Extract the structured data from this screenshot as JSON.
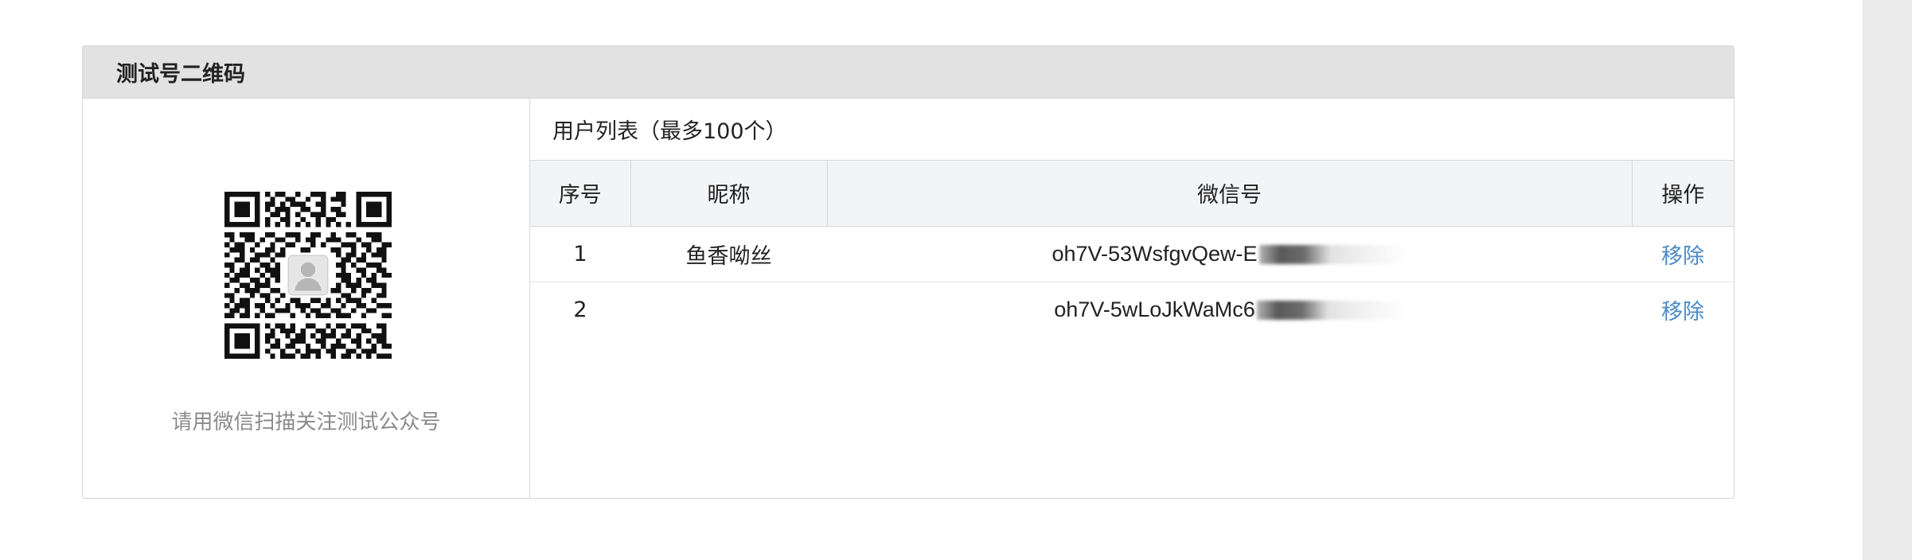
{
  "panel": {
    "title": "测试号二维码"
  },
  "qr": {
    "icon": "qr-code-icon",
    "caption": "请用微信扫描关注测试公众号"
  },
  "user_list": {
    "caption": "用户列表（最多100个）",
    "headers": {
      "index": "序号",
      "nickname": "昵称",
      "wechat_id": "微信号",
      "operation": "操作"
    },
    "rows": [
      {
        "index": "1",
        "nickname": "鱼香呦丝",
        "wechat_id_visible": "oh7V-53WsfgvQew-E",
        "action": "移除"
      },
      {
        "index": "2",
        "nickname": "",
        "wechat_id_visible": "oh7V-5wLoJkWaMc6",
        "action": "移除"
      }
    ]
  },
  "colors": {
    "header_background": "#e2e2e2",
    "table_header_background": "#f3f4f6",
    "link": "#4a8ac8",
    "muted_text": "#8a8a8a"
  }
}
